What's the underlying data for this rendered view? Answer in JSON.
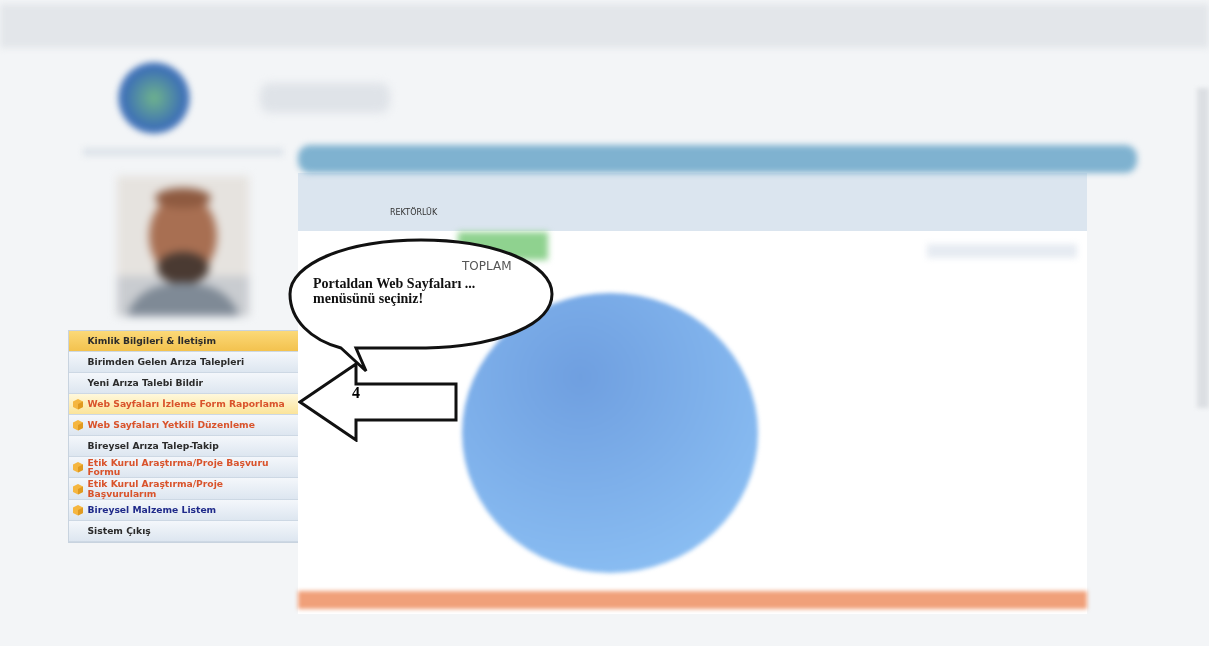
{
  "info_panel": {
    "unit": "REKTÖRLÜK"
  },
  "main_panel": {
    "summary_label": "TOPLAM"
  },
  "menu": [
    {
      "label": "Kimlik Bilgileri & İletişim",
      "selected": true,
      "highlighted": false,
      "icon": false,
      "color": "#2b2b2b"
    },
    {
      "label": "Birimden Gelen Arıza Talepleri",
      "selected": false,
      "highlighted": false,
      "icon": false,
      "color": "#2b2b2b"
    },
    {
      "label": "Yeni Arıza Talebi Bildir",
      "selected": false,
      "highlighted": false,
      "icon": false,
      "color": "#2b2b2b"
    },
    {
      "label": "Web Sayfaları İzleme Form Raporlama",
      "selected": false,
      "highlighted": true,
      "icon": true,
      "color": "#d9532b"
    },
    {
      "label": "Web Sayfaları Yetkili Düzenleme",
      "selected": false,
      "highlighted": false,
      "icon": true,
      "color": "#d9532b"
    },
    {
      "label": "Bireysel Arıza Talep-Takip",
      "selected": false,
      "highlighted": false,
      "icon": false,
      "color": "#2b2b2b"
    },
    {
      "label": "Etik Kurul Araştırma/Proje Başvuru Formu",
      "selected": false,
      "highlighted": false,
      "icon": true,
      "color": "#d9532b"
    },
    {
      "label": "Etik Kurul Araştırma/Proje Başvurularım",
      "selected": false,
      "highlighted": false,
      "icon": true,
      "color": "#d9532b"
    },
    {
      "label": "Bireysel Malzeme Listem",
      "selected": false,
      "highlighted": false,
      "icon": true,
      "color": "#1f2a8a"
    },
    {
      "label": "Sistem Çıkış",
      "selected": false,
      "highlighted": false,
      "icon": false,
      "color": "#2b2b2b"
    }
  ],
  "callout": {
    "text": "Portaldan Web Sayfaları ... menüsünü seçiniz!",
    "step": "4"
  }
}
